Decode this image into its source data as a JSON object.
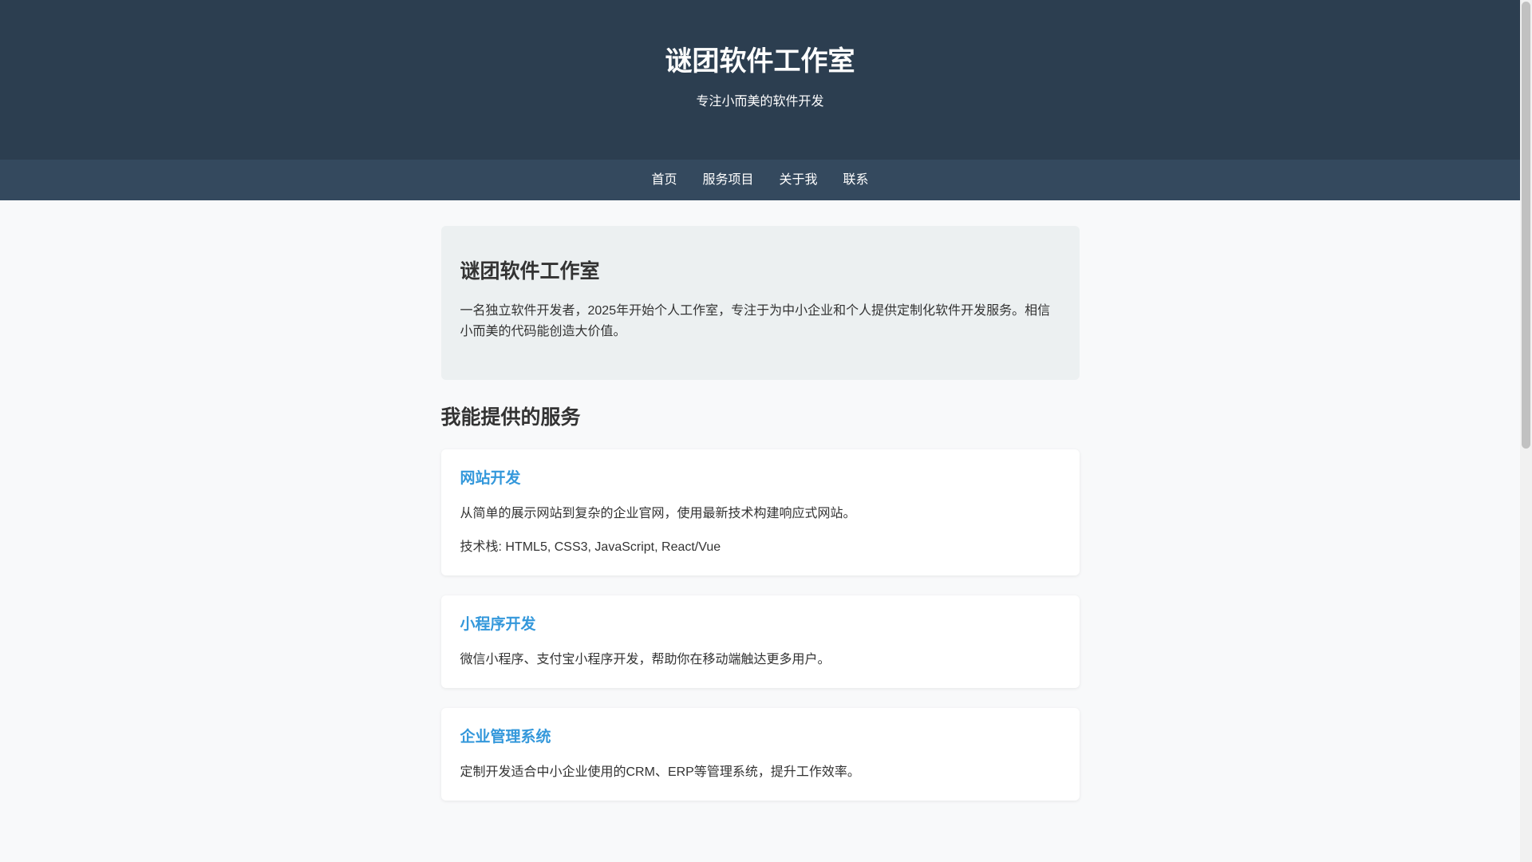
{
  "header": {
    "title": "谜团软件工作室",
    "subtitle": "专注小而美的软件开发"
  },
  "nav": {
    "items": [
      {
        "label": "首页"
      },
      {
        "label": "服务项目"
      },
      {
        "label": "关于我"
      },
      {
        "label": "联系"
      }
    ]
  },
  "intro": {
    "title": "谜团软件工作室",
    "text": "一名独立软件开发者，2025年开始个人工作室，专注于为中小企业和个人提供定制化软件开发服务。相信小而美的代码能创造大价值。"
  },
  "services": {
    "section_title": "我能提供的服务",
    "items": [
      {
        "title": "网站开发",
        "description": "从简单的展示网站到复杂的企业官网，使用最新技术构建响应式网站。",
        "tech": "技术栈: HTML5, CSS3, JavaScript, React/Vue"
      },
      {
        "title": "小程序开发",
        "description": "微信小程序、支付宝小程序开发，帮助你在移动端触达更多用户。"
      },
      {
        "title": "企业管理系统",
        "description": "定制开发适合中小企业使用的CRM、ERP等管理系统，提升工作效率。"
      }
    ]
  },
  "colors": {
    "header_bg": "#2c3e50",
    "nav_bg": "#34495e",
    "accent": "#3498db",
    "intro_bg": "#ecf0f1"
  }
}
